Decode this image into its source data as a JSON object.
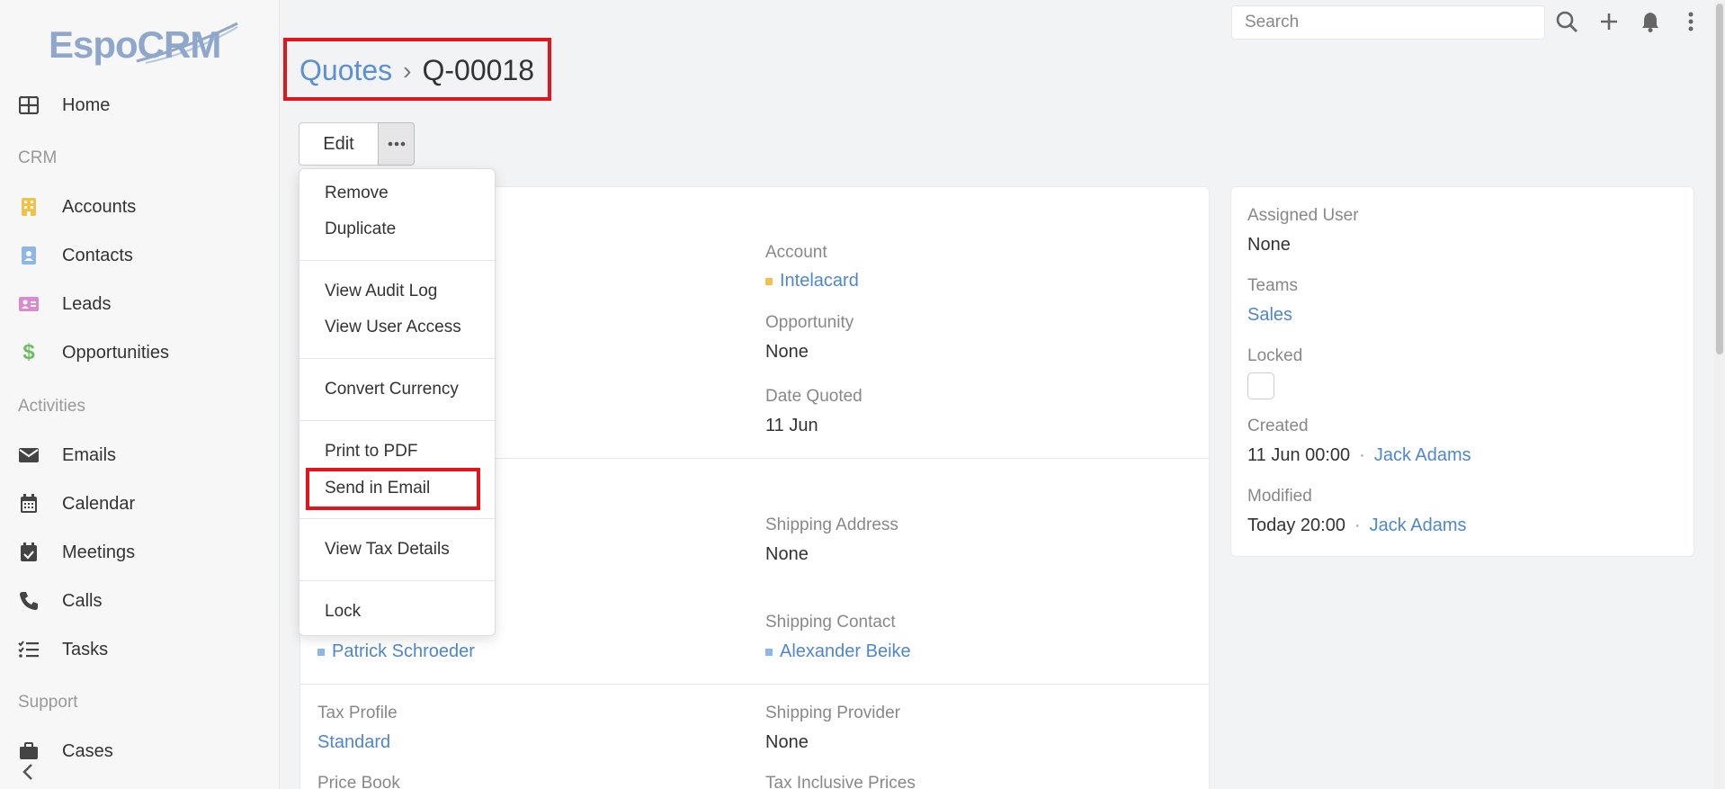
{
  "app": {
    "logo_text": "EspoCRM"
  },
  "sidebar": {
    "items": [
      {
        "label": "Home",
        "icon": "home-grid-icon"
      },
      {
        "group": "CRM"
      },
      {
        "label": "Accounts",
        "icon": "building-icon",
        "color": "#f2c14a"
      },
      {
        "label": "Contacts",
        "icon": "contact-card-icon",
        "color": "#8eb7e6"
      },
      {
        "label": "Leads",
        "icon": "id-card-icon",
        "color": "#d88bcf"
      },
      {
        "label": "Opportunities",
        "icon": "dollar-icon",
        "color": "#6bbf62"
      },
      {
        "group": "Activities"
      },
      {
        "label": "Emails",
        "icon": "envelope-icon"
      },
      {
        "label": "Calendar",
        "icon": "calendar-icon"
      },
      {
        "label": "Meetings",
        "icon": "calendar-check-icon"
      },
      {
        "label": "Calls",
        "icon": "phone-icon"
      },
      {
        "label": "Tasks",
        "icon": "tasks-icon"
      },
      {
        "group": "Support"
      },
      {
        "label": "Cases",
        "icon": "briefcase-icon"
      }
    ]
  },
  "topbar": {
    "search_placeholder": "Search"
  },
  "breadcrumb": {
    "parent": "Quotes",
    "separator": "›",
    "current": "Q-00018"
  },
  "actions": {
    "edit_label": "Edit"
  },
  "dropdown": {
    "items": [
      "Remove",
      "Duplicate",
      "View Audit Log",
      "View User Access",
      "Convert Currency",
      "Print to PDF",
      "Send in Email",
      "View Tax Details",
      "Lock"
    ]
  },
  "main": {
    "account_label": "Account",
    "account_value": "Intelacard",
    "opportunity_label": "Opportunity",
    "opportunity_value": "None",
    "date_quoted_label": "Date Quoted",
    "date_quoted_value": "11 Jun",
    "shipping_address_label": "Shipping Address",
    "shipping_address_value": "None",
    "billing_contact_value": "Patrick Schroeder",
    "shipping_contact_label": "Shipping Contact",
    "shipping_contact_value": "Alexander Beike",
    "tax_profile_label": "Tax Profile",
    "tax_profile_value": "Standard",
    "shipping_provider_label": "Shipping Provider",
    "shipping_provider_value": "None",
    "price_book_label": "Price Book",
    "tax_inclusive_label": "Tax Inclusive Prices"
  },
  "side": {
    "assigned_user_label": "Assigned User",
    "assigned_user_value": "None",
    "teams_label": "Teams",
    "teams_value": "Sales",
    "locked_label": "Locked",
    "created_label": "Created",
    "created_date": "11 Jun 00:00",
    "created_by": "Jack Adams",
    "modified_label": "Modified",
    "modified_date": "Today 20:00",
    "modified_by": "Jack Adams",
    "separator": "·"
  },
  "colors": {
    "accent": "#4f86cc",
    "highlight": "#e0161c",
    "account_dot": "#f2c14a",
    "contact_dot": "#8eb7e6"
  }
}
